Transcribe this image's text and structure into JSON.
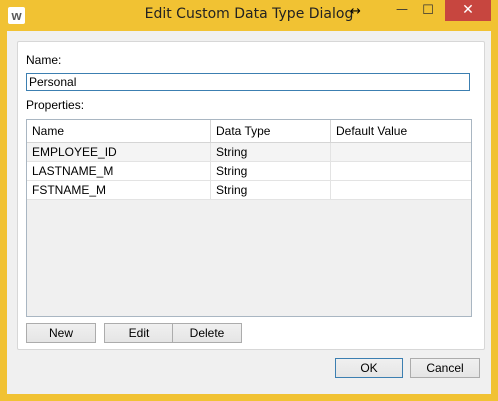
{
  "window": {
    "title": "Edit Custom Data Type Dialog",
    "app_icon_letter": "w",
    "resize_cursor": "↔",
    "minimize": "—",
    "maximize": "☐",
    "close": "✕"
  },
  "form": {
    "name_label": "Name:",
    "name_value": "Personal",
    "properties_label": "Properties:"
  },
  "grid": {
    "columns": [
      "Name",
      "Data Type",
      "Default Value"
    ],
    "rows": [
      {
        "name": "EMPLOYEE_ID",
        "data_type": "String",
        "default_value": ""
      },
      {
        "name": "LASTNAME_M",
        "data_type": "String",
        "default_value": ""
      },
      {
        "name": "FSTNAME_M",
        "data_type": "String",
        "default_value": ""
      }
    ]
  },
  "grid_buttons": {
    "new": "New",
    "edit": "Edit",
    "delete": "Delete"
  },
  "dialog_buttons": {
    "ok": "OK",
    "cancel": "Cancel"
  },
  "colors": {
    "title_bar": "#f1c233",
    "close_button": "#c7463f",
    "focus_border": "#3c7fb1"
  }
}
